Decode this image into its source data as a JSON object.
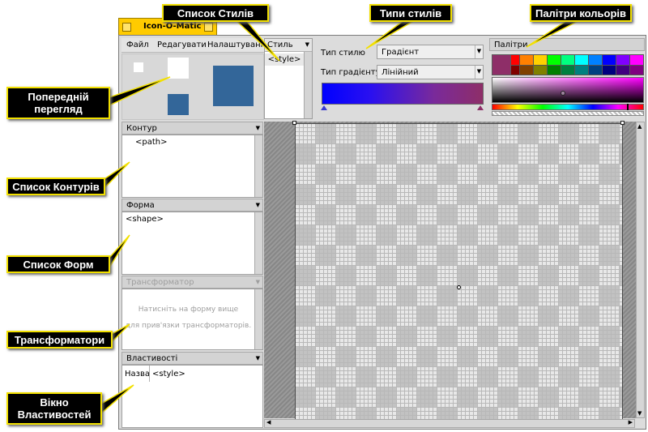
{
  "window": {
    "title": "Icon-O-Matic"
  },
  "menu": [
    "Файл",
    "Редагувати",
    "Налаштування"
  ],
  "style_list": {
    "header": "Стиль",
    "items": [
      "<style>"
    ]
  },
  "style_props": {
    "style_type_label": "Тип стилю",
    "style_type_value": "Градієнт",
    "gradient_type_label": "Тип градієнту",
    "gradient_type_value": "Лінійний"
  },
  "palette": {
    "header": "Палітри",
    "selected_color": "#8e2e68"
  },
  "path_panel": {
    "header": "Контур",
    "items": [
      "<path>"
    ]
  },
  "shape_panel": {
    "header": "Форма",
    "items": [
      "<shape>"
    ]
  },
  "transformer_panel": {
    "header": "Трансформатор",
    "hint_line1": "Натисніть на форму вище",
    "hint_line2": "для прив'язки трансформаторів."
  },
  "properties_panel": {
    "header": "Властивості",
    "name_label": "Назва",
    "name_value": "<style>"
  },
  "callouts": {
    "style_list": "Список Стилів",
    "style_types": "Типи стилів",
    "palettes": "Палітри кольорів",
    "preview": "Попередній перегляд",
    "path_list": "Список Контурів",
    "shape_list": "Список Форм",
    "transformers": "Трансформатори",
    "properties": "Вікно Властивостей"
  },
  "colors": {
    "callout_border": "#f2e000",
    "callout_bg": "#000000",
    "tab": "#ffcb00",
    "preview_blue": "#336699"
  }
}
